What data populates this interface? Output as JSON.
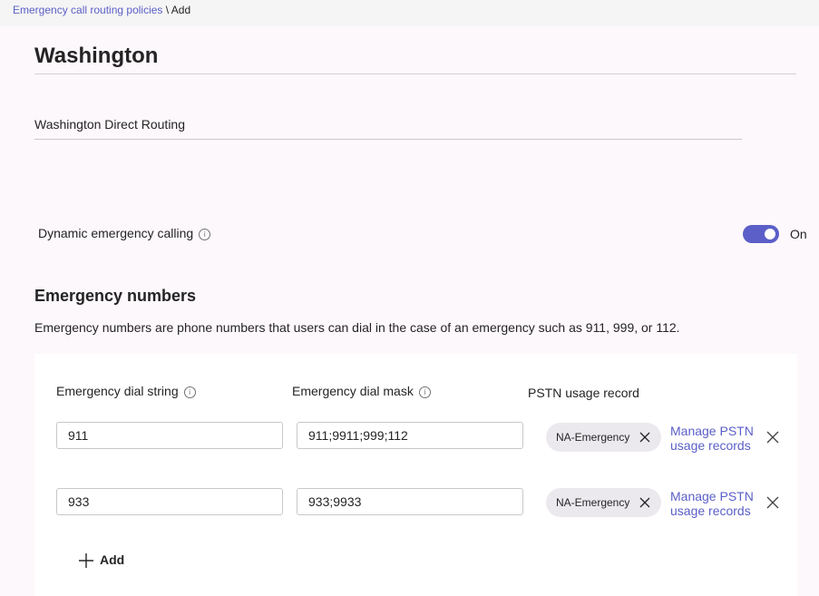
{
  "breadcrumb": {
    "parent": "Emergency call routing policies",
    "separator": " \\ ",
    "current": "Add"
  },
  "policy": {
    "name": "Washington",
    "description": "Washington Direct Routing"
  },
  "dynamic_calling": {
    "label": "Dynamic emergency calling",
    "state": "On",
    "enabled": true
  },
  "emergency_numbers": {
    "title": "Emergency numbers",
    "description": "Emergency numbers are phone numbers that users can dial in the case of an emergency such as 911, 999, or 112.",
    "columns": {
      "dial_string": "Emergency dial string",
      "dial_mask": "Emergency dial mask",
      "pstn_usage": "PSTN usage record"
    },
    "rows": [
      {
        "dial_string": "911",
        "dial_mask": "911;9911;999;112",
        "pstn_record": "NA-Emergency",
        "manage_link_line1": "Manage PSTN",
        "manage_link_line2": "usage records"
      },
      {
        "dial_string": "933",
        "dial_mask": "933;9933",
        "pstn_record": "NA-Emergency",
        "manage_link_line1": "Manage PSTN",
        "manage_link_line2": "usage records"
      }
    ],
    "add_label": "Add"
  },
  "colors": {
    "accent": "#5b5fc7",
    "background": "#fdf8fc",
    "card": "#ffffff",
    "chip": "#ece9ee"
  },
  "icons": {
    "info": "info-icon",
    "remove": "close-icon",
    "add": "plus-icon"
  }
}
